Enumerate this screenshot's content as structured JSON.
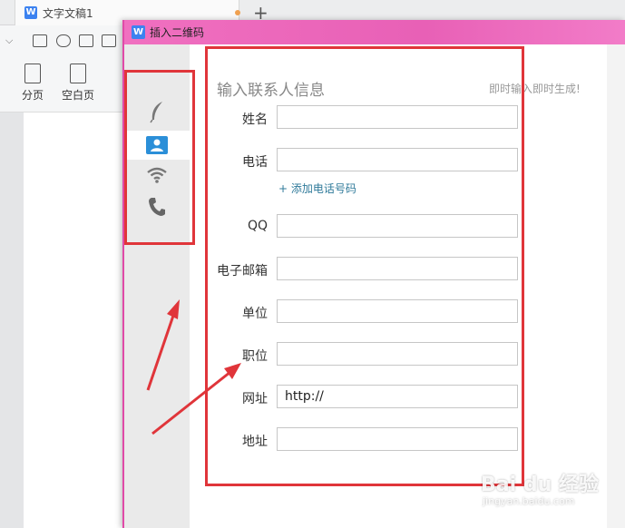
{
  "app": {
    "tab_title": "文字文稿1",
    "new_tab_label": "+",
    "logo_letter": "W"
  },
  "toolbar": {
    "page_break_label": "分页",
    "blank_page_label": "空白页"
  },
  "dialog": {
    "title": "插入二维码",
    "logo_letter": "W",
    "header": "输入联系人信息",
    "hint": "即时输入即时生成!",
    "add_phone": "+ 添加电话号码",
    "fields": {
      "name": {
        "label": "姓名",
        "value": ""
      },
      "phone": {
        "label": "电话",
        "value": ""
      },
      "qq": {
        "label": "QQ",
        "value": ""
      },
      "email": {
        "label": "电子邮箱",
        "value": ""
      },
      "company": {
        "label": "单位",
        "value": ""
      },
      "position": {
        "label": "职位",
        "value": ""
      },
      "website": {
        "label": "网址",
        "value": "http://"
      },
      "address": {
        "label": "地址",
        "value": ""
      }
    },
    "sidebar_icons": [
      "feather-icon",
      "contact-card-icon",
      "wifi-icon",
      "phone-icon"
    ]
  },
  "colors": {
    "title_bar": "#e860b6",
    "accent_blue": "#2b8fd8",
    "annotation_red": "#e0353a"
  },
  "watermark": {
    "logo": "Bai du 经验",
    "url": "jingyan.baidu.com"
  }
}
